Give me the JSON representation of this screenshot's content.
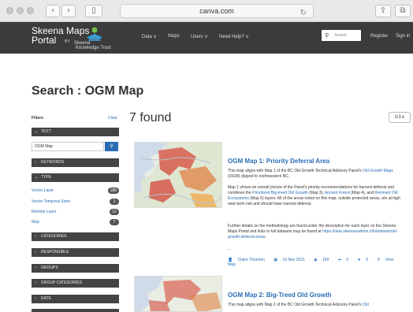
{
  "browser": {
    "url": "canva.com",
    "back_icon": "chevron-left-icon",
    "forward_icon": "chevron-right-icon",
    "reload_icon": "reload-icon"
  },
  "header": {
    "title_line1": "Skeena Maps",
    "title_line2": "Portal",
    "by": "BY",
    "partner_line1": "Skeena",
    "partner_line2": "Knowledge Trust",
    "nav": [
      {
        "label": "Data ∨"
      },
      {
        "label": "Maps"
      },
      {
        "label": "Users ∨"
      },
      {
        "label": "Need Help? ∨"
      }
    ],
    "search_placeholder": "Search",
    "register": "Register",
    "signin": "Sign in"
  },
  "page": {
    "title": "Search : OGM Map"
  },
  "sidebar": {
    "filters_label": "Filters",
    "clear_label": "Clear",
    "text_heading": "TEXT",
    "text_value": "OGM Map",
    "keywords_heading": "KEYWORDS",
    "type_heading": "TYPE",
    "types": [
      {
        "label": "Vector Layer",
        "count": "188"
      },
      {
        "label": "Vector Temporal Serie",
        "count": "1"
      },
      {
        "label": "Remote Layer",
        "count": "12"
      },
      {
        "label": "Map",
        "count": "7"
      }
    ],
    "sections": [
      {
        "label": "CATEGORIES"
      },
      {
        "label": "RESPONSIBLE"
      },
      {
        "label": "GROUPS"
      },
      {
        "label": "GROUP CATEGORIES"
      },
      {
        "label": "DATE"
      }
    ]
  },
  "results": {
    "count_label": "7 found",
    "sort_label": "⊙1∨",
    "items": [
      {
        "title": "OGM Map 1: Priority Deferral Area",
        "p1_a": "This map aligns with Map 1 of the BC Old Growth Technical Advisory Panel's ",
        "p1_link": "Old Growth Maps",
        "p1_b": " (OGM) clipped to northwestern BC.",
        "p2_a": "Map 1 shows an overall picture of the Panel's priority recommendations for harvest deferral and combines the ",
        "p2_link1": "Prioritized Big-treed Old Growth",
        "p2_b": " (Map 3), ",
        "p2_link2": "Ancient Forest",
        "p2_c": " (Map 4), and ",
        "p2_link3": "Remnant Old Ecosystems",
        "p2_d": " (Map 5) layers. All of the areas noted on this map, outside protected areas, are at high near-term risk and should have harvest deferral.",
        "p3_a": "Further details on the methodology are found under the description for each layer on the Skeena Maps Portal and links to full datasets may be found at ",
        "p3_link": "https://data.skeenasalmon.info/dataset/old-growth-deferral-areas",
        "p3_b": ".",
        "ellipsis": "...",
        "author": "Claire Thornton",
        "date": "19 Nov 2021",
        "views": "160",
        "shares": "0",
        "stars": "0",
        "view_map": "View Map"
      },
      {
        "title": "OGM Map 2: Big-Treed Old Growth",
        "p1_a": "This map aligns with Map 2 of the BC Old Growth Technical Advisory Panel's ",
        "p1_link": "Old"
      }
    ]
  }
}
